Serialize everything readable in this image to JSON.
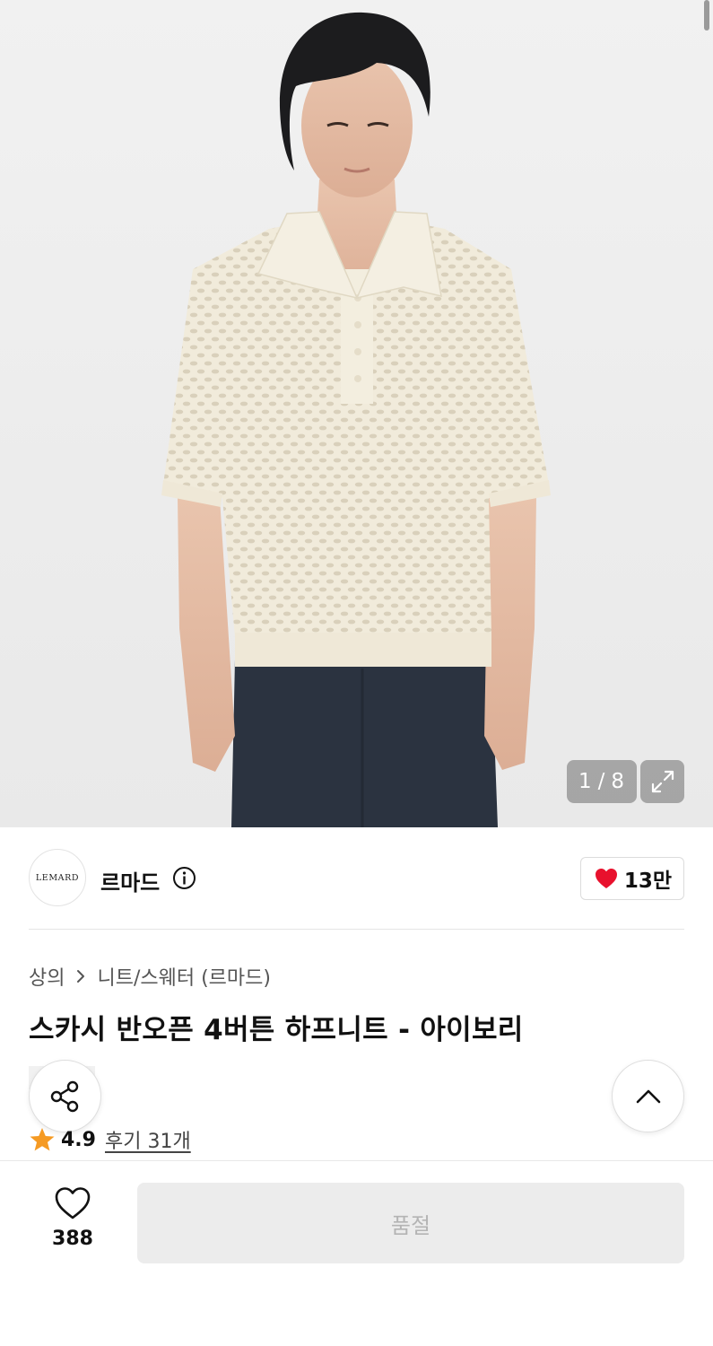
{
  "gallery": {
    "current_page": "1",
    "separator": "/",
    "total_pages": "8",
    "image_subject": "model wearing ivory crochet knit polo shirt with navy trousers"
  },
  "brand": {
    "logo_text": "LEMARD",
    "name": "르마드",
    "likes": "13만"
  },
  "breadcrumb": {
    "category": "상의",
    "subcategory": "니트/스웨터 (르마드)"
  },
  "product": {
    "title": "스카시 반오픈 4버튼 하프니트 - 아이보리"
  },
  "rating": {
    "score": "4.9",
    "reviews": "후기 31개"
  },
  "bottom_bar": {
    "wish_count": "388",
    "purchase_label": "품절"
  },
  "colors": {
    "accent_heart": "#e8112d",
    "star": "#f59a23",
    "soldout_bg": "#ececec",
    "soldout_text": "#b4b4b4"
  }
}
